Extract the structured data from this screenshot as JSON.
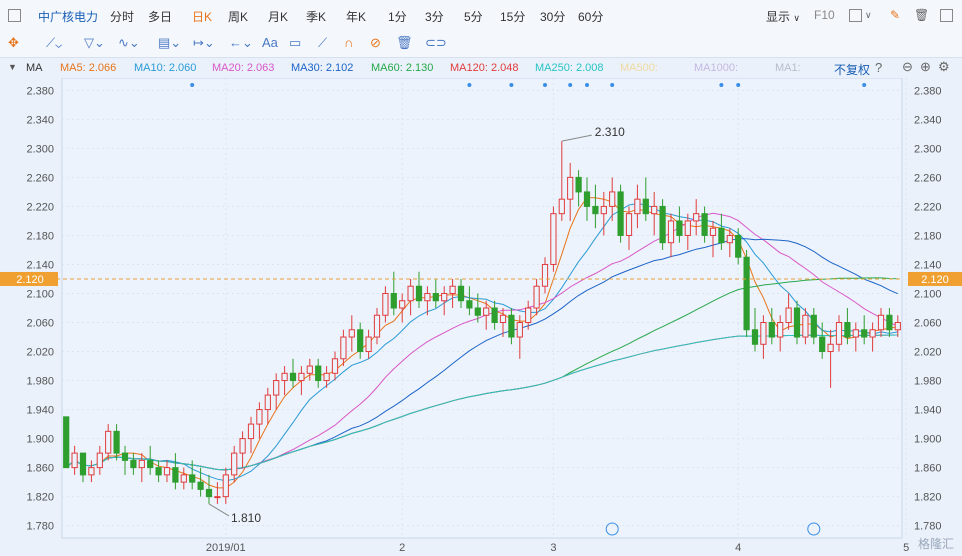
{
  "header": {
    "stock_name": "中广核电力",
    "periods": [
      "分时",
      "多日",
      "日K",
      "周K",
      "月K",
      "季K",
      "年K",
      "1分",
      "3分",
      "5分",
      "15分",
      "30分",
      "60分"
    ],
    "active_period": "日K",
    "display_label": "显示",
    "f10_label": "F10"
  },
  "mabar": {
    "label": "MA",
    "items": [
      {
        "text": "MA5: 2.066",
        "color": "#e8741a"
      },
      {
        "text": "MA10: 2.060",
        "color": "#2a9bd6"
      },
      {
        "text": "MA20: 2.063",
        "color": "#d957c7"
      },
      {
        "text": "MA30: 2.102",
        "color": "#1c64c8"
      },
      {
        "text": "MA60: 2.130",
        "color": "#27a84a"
      },
      {
        "text": "MA120: 2.048",
        "color": "#e03c3c"
      },
      {
        "text": "MA250: 2.008",
        "color": "#29c4c4"
      },
      {
        "text": "MA500:",
        "color": "#f0d9a0"
      },
      {
        "text": "MA1000:",
        "color": "#c5b8e0"
      },
      {
        "text": "MA1:",
        "color": "#b5bfca"
      }
    ],
    "fq_label": "不复权"
  },
  "chart_data": {
    "type": "candlestick",
    "y_ticks": [
      "2.380",
      "2.340",
      "2.300",
      "2.260",
      "2.220",
      "2.180",
      "2.140",
      "2.100",
      "2.060",
      "2.020",
      "1.980",
      "1.940",
      "1.900",
      "1.860",
      "1.820",
      "1.780"
    ],
    "ylim": [
      1.763,
      2.397
    ],
    "x_labels": [
      {
        "text": "2019/01",
        "i": 19
      },
      {
        "text": "2",
        "i": 40
      },
      {
        "text": "3",
        "i": 58
      },
      {
        "text": "4",
        "i": 80
      },
      {
        "text": "5",
        "i": 100
      }
    ],
    "current_price": "2.120",
    "high_label": "2.310",
    "low_label": "1.810",
    "ohlc": [
      [
        1.93,
        1.93,
        1.86,
        1.86
      ],
      [
        1.86,
        1.89,
        1.85,
        1.88
      ],
      [
        1.88,
        1.88,
        1.84,
        1.85
      ],
      [
        1.85,
        1.87,
        1.84,
        1.86
      ],
      [
        1.86,
        1.89,
        1.85,
        1.88
      ],
      [
        1.88,
        1.92,
        1.87,
        1.91
      ],
      [
        1.91,
        1.92,
        1.87,
        1.88
      ],
      [
        1.88,
        1.89,
        1.85,
        1.87
      ],
      [
        1.87,
        1.88,
        1.85,
        1.86
      ],
      [
        1.86,
        1.88,
        1.84,
        1.87
      ],
      [
        1.87,
        1.89,
        1.85,
        1.86
      ],
      [
        1.86,
        1.87,
        1.84,
        1.85
      ],
      [
        1.85,
        1.87,
        1.84,
        1.86
      ],
      [
        1.86,
        1.88,
        1.83,
        1.84
      ],
      [
        1.84,
        1.86,
        1.83,
        1.85
      ],
      [
        1.85,
        1.87,
        1.83,
        1.84
      ],
      [
        1.84,
        1.86,
        1.82,
        1.83
      ],
      [
        1.83,
        1.85,
        1.81,
        1.82
      ],
      [
        1.82,
        1.84,
        1.81,
        1.82
      ],
      [
        1.82,
        1.86,
        1.81,
        1.85
      ],
      [
        1.85,
        1.89,
        1.84,
        1.88
      ],
      [
        1.88,
        1.91,
        1.86,
        1.9
      ],
      [
        1.9,
        1.93,
        1.88,
        1.92
      ],
      [
        1.92,
        1.95,
        1.9,
        1.94
      ],
      [
        1.94,
        1.97,
        1.92,
        1.96
      ],
      [
        1.96,
        1.99,
        1.94,
        1.98
      ],
      [
        1.98,
        2.0,
        1.96,
        1.99
      ],
      [
        1.99,
        2.01,
        1.97,
        1.98
      ],
      [
        1.98,
        2.0,
        1.96,
        1.99
      ],
      [
        1.99,
        2.01,
        1.98,
        2.0
      ],
      [
        2.0,
        2.01,
        1.97,
        1.98
      ],
      [
        1.98,
        2.0,
        1.97,
        1.99
      ],
      [
        1.99,
        2.02,
        1.98,
        2.01
      ],
      [
        2.01,
        2.05,
        2.0,
        2.04
      ],
      [
        2.04,
        2.07,
        2.02,
        2.05
      ],
      [
        2.05,
        2.06,
        2.01,
        2.02
      ],
      [
        2.02,
        2.05,
        2.01,
        2.04
      ],
      [
        2.04,
        2.08,
        2.03,
        2.07
      ],
      [
        2.07,
        2.11,
        2.06,
        2.1
      ],
      [
        2.1,
        2.13,
        2.07,
        2.08
      ],
      [
        2.08,
        2.1,
        2.06,
        2.09
      ],
      [
        2.09,
        2.12,
        2.07,
        2.11
      ],
      [
        2.11,
        2.13,
        2.08,
        2.09
      ],
      [
        2.09,
        2.11,
        2.07,
        2.1
      ],
      [
        2.1,
        2.12,
        2.08,
        2.09
      ],
      [
        2.09,
        2.11,
        2.07,
        2.1
      ],
      [
        2.1,
        2.12,
        2.08,
        2.11
      ],
      [
        2.11,
        2.12,
        2.08,
        2.09
      ],
      [
        2.09,
        2.11,
        2.07,
        2.08
      ],
      [
        2.08,
        2.1,
        2.06,
        2.07
      ],
      [
        2.07,
        2.09,
        2.05,
        2.08
      ],
      [
        2.08,
        2.09,
        2.05,
        2.06
      ],
      [
        2.06,
        2.08,
        2.04,
        2.07
      ],
      [
        2.07,
        2.08,
        2.03,
        2.04
      ],
      [
        2.04,
        2.07,
        2.01,
        2.06
      ],
      [
        2.06,
        2.09,
        2.05,
        2.08
      ],
      [
        2.08,
        2.12,
        2.07,
        2.11
      ],
      [
        2.11,
        2.15,
        2.1,
        2.14
      ],
      [
        2.14,
        2.22,
        2.13,
        2.21
      ],
      [
        2.21,
        2.31,
        2.2,
        2.23
      ],
      [
        2.23,
        2.28,
        2.2,
        2.26
      ],
      [
        2.26,
        2.27,
        2.22,
        2.24
      ],
      [
        2.24,
        2.26,
        2.2,
        2.22
      ],
      [
        2.22,
        2.25,
        2.19,
        2.21
      ],
      [
        2.21,
        2.24,
        2.18,
        2.22
      ],
      [
        2.22,
        2.26,
        2.2,
        2.24
      ],
      [
        2.24,
        2.25,
        2.17,
        2.18
      ],
      [
        2.18,
        2.22,
        2.16,
        2.21
      ],
      [
        2.21,
        2.25,
        2.19,
        2.23
      ],
      [
        2.23,
        2.26,
        2.2,
        2.21
      ],
      [
        2.21,
        2.24,
        2.18,
        2.22
      ],
      [
        2.22,
        2.23,
        2.16,
        2.17
      ],
      [
        2.17,
        2.21,
        2.15,
        2.2
      ],
      [
        2.2,
        2.22,
        2.17,
        2.18
      ],
      [
        2.18,
        2.21,
        2.16,
        2.2
      ],
      [
        2.2,
        2.23,
        2.18,
        2.21
      ],
      [
        2.21,
        2.22,
        2.17,
        2.18
      ],
      [
        2.18,
        2.2,
        2.15,
        2.19
      ],
      [
        2.19,
        2.21,
        2.16,
        2.17
      ],
      [
        2.17,
        2.19,
        2.15,
        2.18
      ],
      [
        2.18,
        2.19,
        2.14,
        2.15
      ],
      [
        2.15,
        2.16,
        2.04,
        2.05
      ],
      [
        2.05,
        2.08,
        2.02,
        2.03
      ],
      [
        2.03,
        2.07,
        2.01,
        2.06
      ],
      [
        2.06,
        2.08,
        2.03,
        2.04
      ],
      [
        2.04,
        2.07,
        2.02,
        2.06
      ],
      [
        2.06,
        2.1,
        2.05,
        2.08
      ],
      [
        2.08,
        2.09,
        2.03,
        2.04
      ],
      [
        2.04,
        2.08,
        2.03,
        2.07
      ],
      [
        2.07,
        2.08,
        2.03,
        2.04
      ],
      [
        2.04,
        2.06,
        2.01,
        2.02
      ],
      [
        2.02,
        2.05,
        1.97,
        2.03
      ],
      [
        2.03,
        2.07,
        2.02,
        2.06
      ],
      [
        2.06,
        2.08,
        2.03,
        2.04
      ],
      [
        2.04,
        2.06,
        2.02,
        2.05
      ],
      [
        2.05,
        2.07,
        2.03,
        2.04
      ],
      [
        2.04,
        2.06,
        2.02,
        2.05
      ],
      [
        2.05,
        2.08,
        2.04,
        2.07
      ],
      [
        2.07,
        2.08,
        2.04,
        2.05
      ],
      [
        2.05,
        2.07,
        2.04,
        2.06
      ]
    ]
  },
  "watermark": "格隆汇"
}
